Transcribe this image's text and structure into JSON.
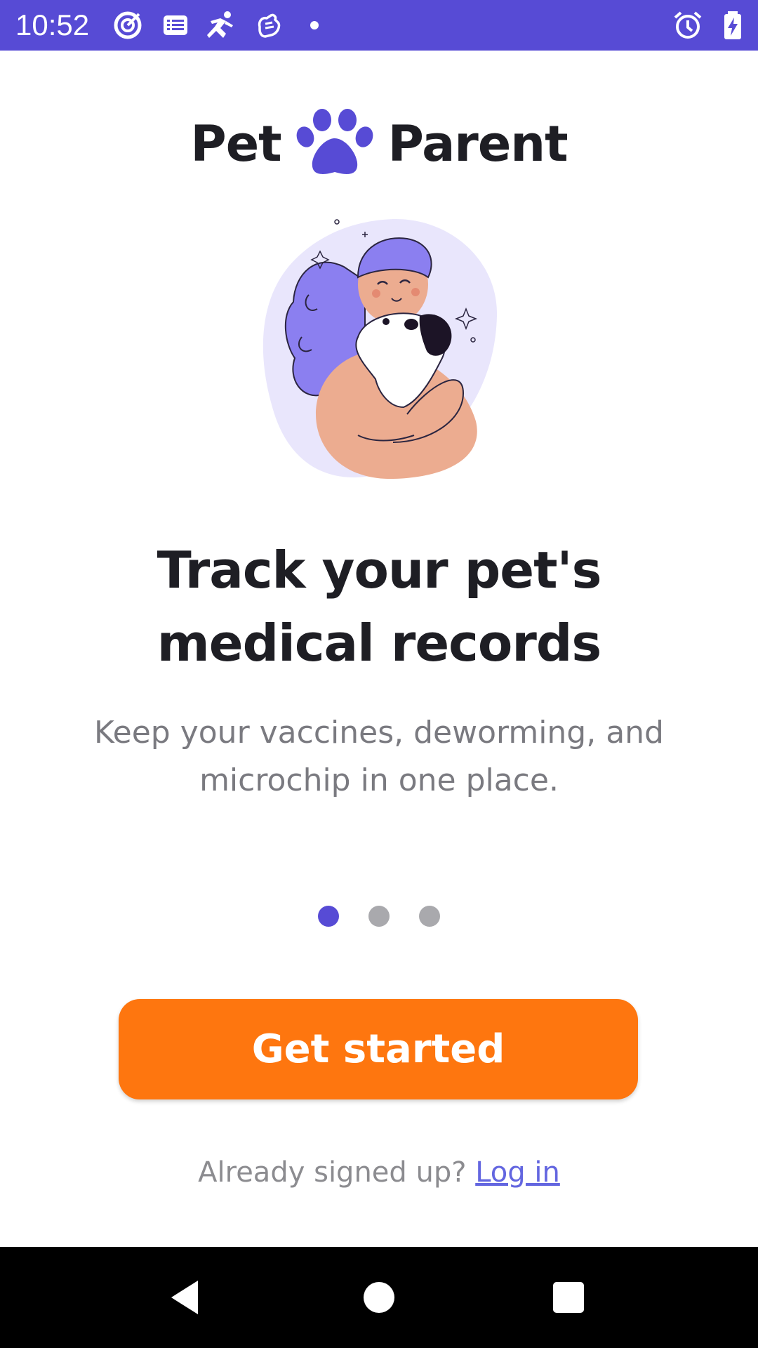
{
  "status_bar": {
    "time": "10:52",
    "left_icons": [
      "target-icon",
      "list-icon",
      "runner-icon",
      "hand-icon",
      "dot-icon"
    ],
    "right_icons": [
      "alarm-icon",
      "battery-charging-icon"
    ],
    "background": "#574bd5"
  },
  "logo": {
    "word_left": "Pet",
    "word_right": "Parent",
    "icon": "paw-icon",
    "icon_color": "#574bd5"
  },
  "onboarding": {
    "illustration": "woman-hugging-dog-illustration",
    "title": "Track your pet's medical records",
    "subtitle": "Keep your vaccines, deworming, and microchip in one place.",
    "pages": 3,
    "active_page": 1
  },
  "actions": {
    "primary_label": "Get started",
    "primary_color": "#fe760f",
    "signin_prompt": "Already signed up?",
    "signin_link": "Log in"
  },
  "nav_bar": {
    "buttons": [
      "back-icon",
      "home-icon",
      "recents-icon"
    ]
  }
}
